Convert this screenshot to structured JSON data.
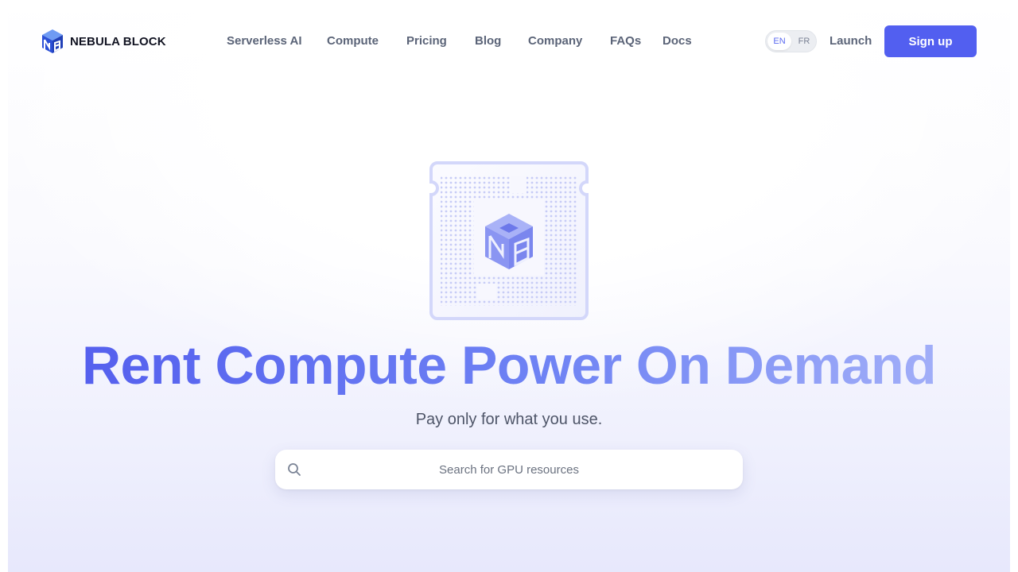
{
  "brand": {
    "name": "NEBULA BLOCK"
  },
  "nav": {
    "items": [
      {
        "label": "Serverless AI"
      },
      {
        "label": "Compute"
      },
      {
        "label": "Pricing"
      },
      {
        "label": "Blog"
      },
      {
        "label": "Company"
      },
      {
        "label": "FAQs"
      },
      {
        "label": "Docs"
      }
    ]
  },
  "language": {
    "options": [
      "EN",
      "FR"
    ],
    "selected": "EN"
  },
  "actions": {
    "launch_label": "Launch",
    "signup_label": "Sign up"
  },
  "hero": {
    "title": "Rent Compute Power On Demand",
    "subtitle": "Pay only for what you use."
  },
  "search": {
    "placeholder": "Search for GPU resources",
    "value": ""
  },
  "colors": {
    "accent": "#525ff0",
    "title_gradient_start": "#5560ee",
    "title_gradient_end": "#a1aef8",
    "nav_text": "#5b6478"
  },
  "icons": {
    "logo": "nebula-block-cube-icon",
    "chip": "gpu-chip-icon",
    "search": "search-icon"
  }
}
